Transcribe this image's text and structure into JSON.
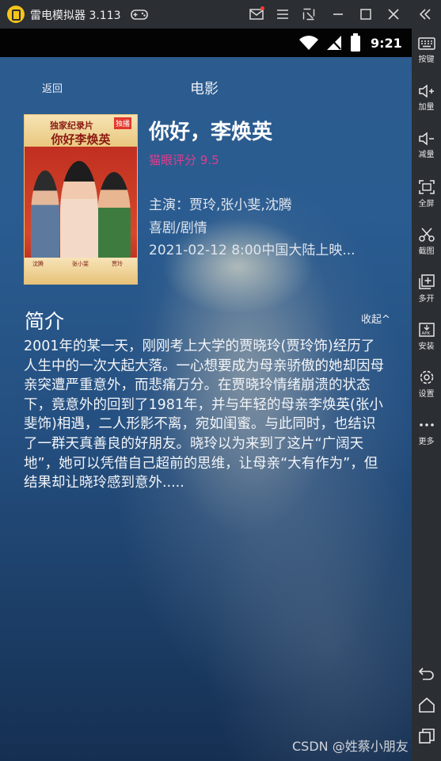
{
  "window": {
    "title": "雷电模拟器 3.113",
    "colors": {
      "chrome": "#2b2e33",
      "accent_logo": "#f5c518"
    }
  },
  "statusbar": {
    "time": "9:21"
  },
  "header": {
    "back_label": "返回",
    "title": "电影"
  },
  "movie": {
    "name": "你好，李焕英",
    "rating": "猫眼评分 9.5",
    "cast": "主演：贾玲,张小斐,沈腾",
    "genre": "喜剧/剧情",
    "release": "2021-02-12 8:00中国大陆上映...",
    "poster": {
      "series": "独家纪录片",
      "badge": "独播",
      "title": "你好李焕英",
      "names": [
        "沈腾",
        "张小斐",
        "贾玲"
      ]
    }
  },
  "synopsis": {
    "title": "简介",
    "collapse_label": "收起^",
    "text": "2001年的某一天，刚刚考上大学的贾晓玲(贾玲饰)经历了人生中的一次大起大落。一心想要成为母亲骄傲的她却因母亲突遭严重意外，而悲痛万分。在贾晓玲情绪崩溃的状态下，竟意外的回到了1981年，并与年轻的母亲李焕英(张小斐饰)相遇，二人形影不离，宛如闺蜜。与此同时，也结识了一群天真善良的好朋友。晓玲以为来到了这片“广阔天地”，她可以凭借自己超前的思维，让母亲“大有作为”，但结果却让晓玲感到意外....."
  },
  "sidebar": {
    "items": [
      {
        "label": "按键",
        "icon": "keyboard-icon"
      },
      {
        "label": "加量",
        "icon": "volume-up-icon"
      },
      {
        "label": "减量",
        "icon": "volume-down-icon"
      },
      {
        "label": "全屏",
        "icon": "fullscreen-icon"
      },
      {
        "label": "截图",
        "icon": "scissors-icon"
      },
      {
        "label": "多开",
        "icon": "multi-instance-icon"
      },
      {
        "label": "安装",
        "icon": "apk-install-icon"
      },
      {
        "label": "设置",
        "icon": "gear-icon"
      },
      {
        "label": "更多",
        "icon": "more-icon"
      }
    ]
  },
  "watermark": "CSDN @姓蔡小朋友",
  "colors": {
    "rating": "#e23c8b",
    "text": "#f3f5f8"
  }
}
